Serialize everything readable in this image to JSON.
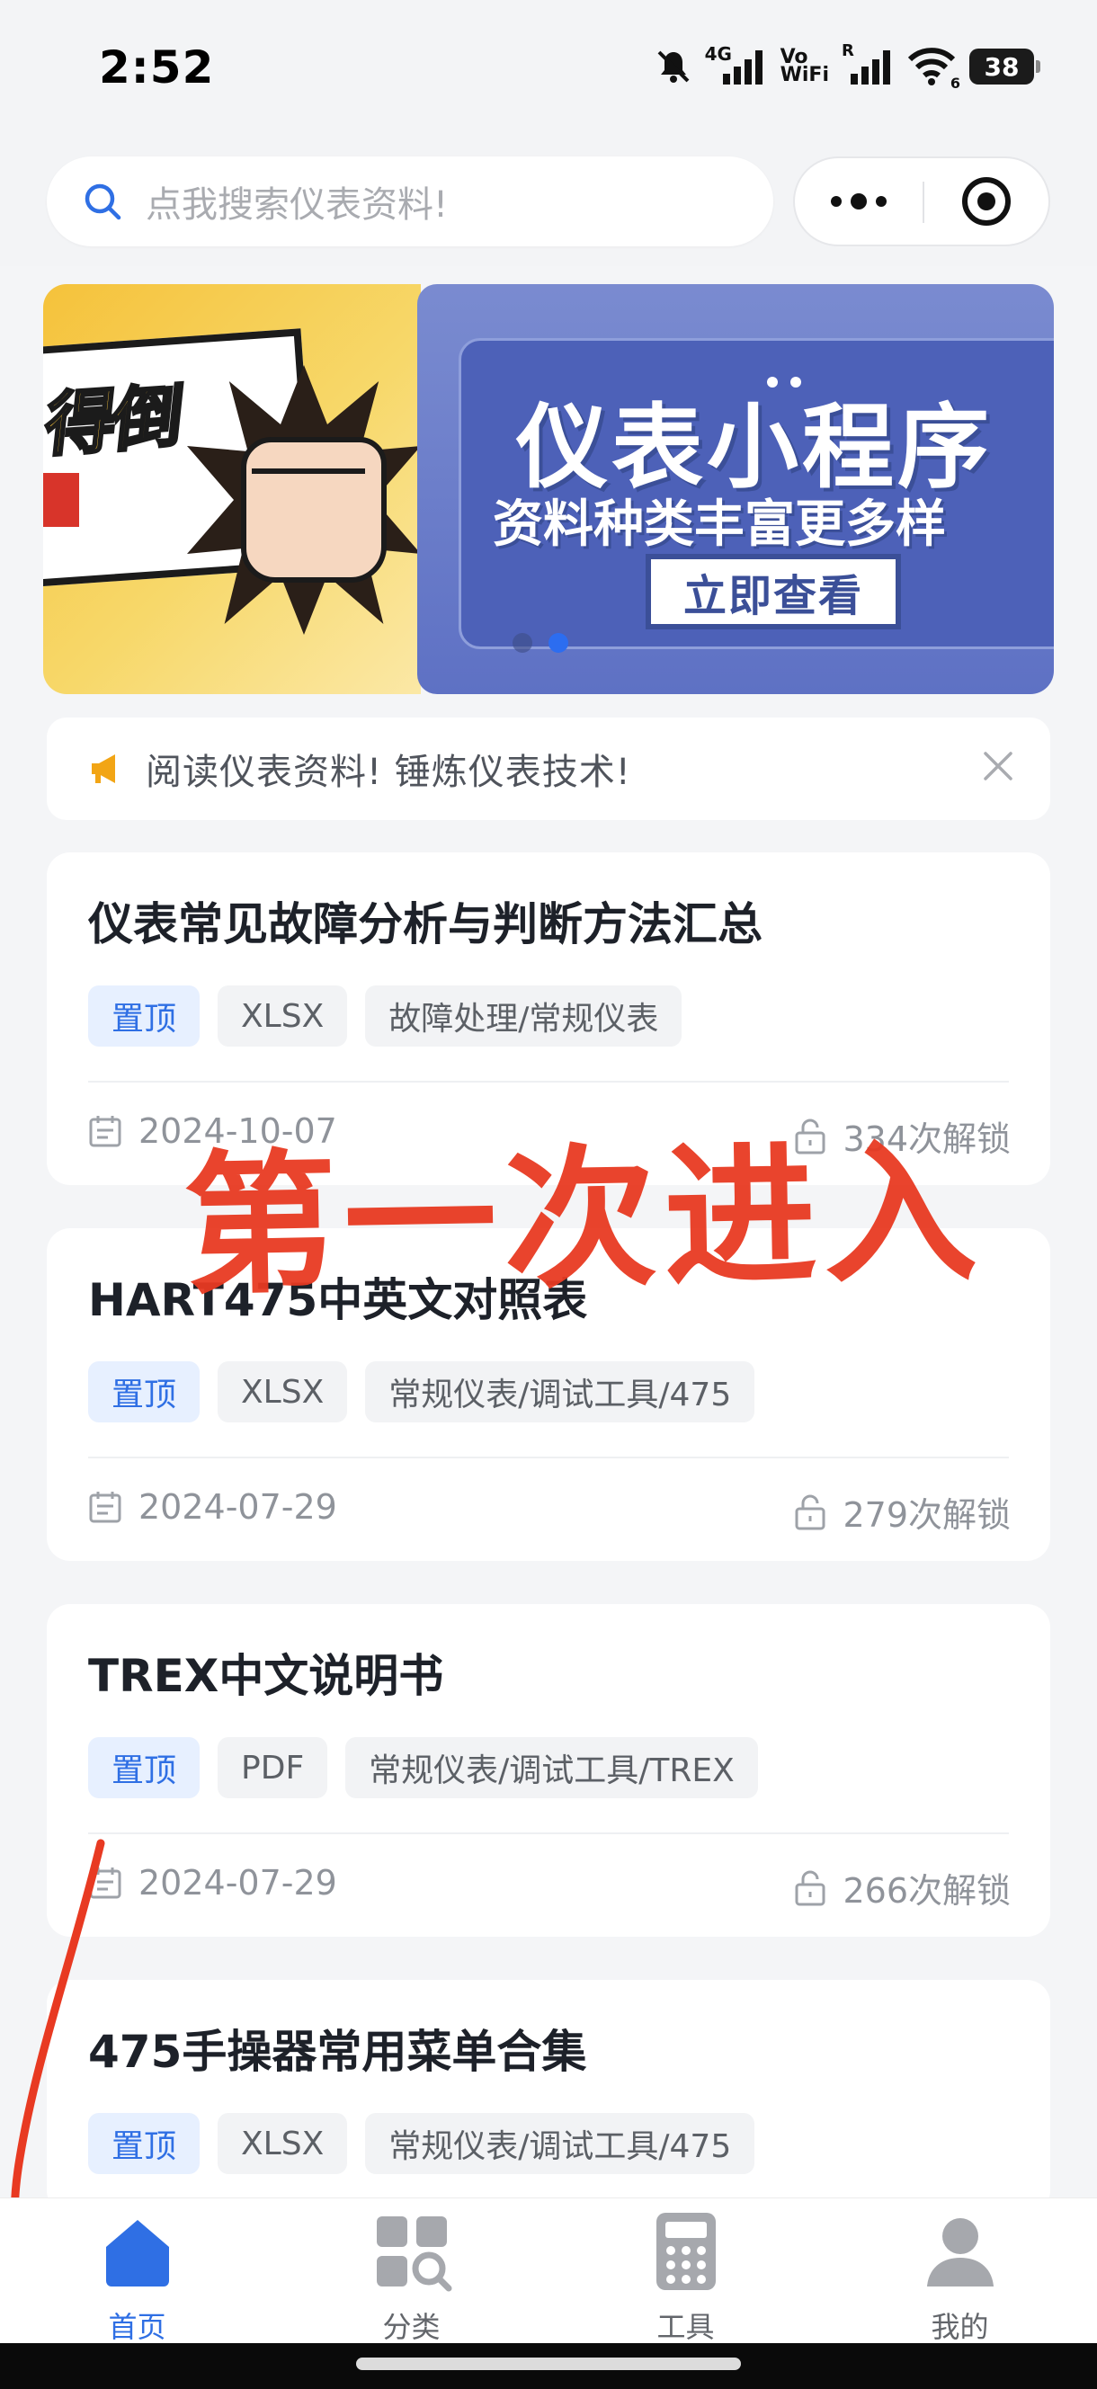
{
  "status_bar": {
    "time": "2:52",
    "network": "4G",
    "vo_label": "Vo",
    "wifi_label": "WiFi",
    "roaming_label": "R",
    "wifi_version": "6",
    "battery": "38"
  },
  "search": {
    "placeholder": "点我搜索仪表资料!"
  },
  "banner": {
    "left_text": "得倒",
    "title": "仪表小程序",
    "subtitle": "资料种类丰富更多样",
    "cta": "立即查看",
    "active_index": 1,
    "slide_count": 2
  },
  "notice": {
    "text": "阅读仪表资料! 锤炼仪表技术!"
  },
  "cards": [
    {
      "title": "仪表常见故障分析与判断方法汇总",
      "tags": [
        "置顶",
        "XLSX",
        "故障处理/常规仪表"
      ],
      "date": "2024-10-07",
      "unlocks": "334次解锁"
    },
    {
      "title": "HART475中英文对照表",
      "tags": [
        "置顶",
        "XLSX",
        "常规仪表/调试工具/475"
      ],
      "date": "2024-07-29",
      "unlocks": "279次解锁"
    },
    {
      "title": "TREX中文说明书",
      "tags": [
        "置顶",
        "PDF",
        "常规仪表/调试工具/TREX"
      ],
      "date": "2024-07-29",
      "unlocks": "266次解锁"
    },
    {
      "title": "475手操器常用菜单合集",
      "tags": [
        "置顶",
        "XLSX",
        "常规仪表/调试工具/475"
      ]
    }
  ],
  "overlay_annotation": "第一次进入",
  "tabbar": [
    {
      "label": "首页",
      "icon": "home-icon",
      "active": true
    },
    {
      "label": "分类",
      "icon": "category-icon",
      "active": false
    },
    {
      "label": "工具",
      "icon": "calculator-icon",
      "active": false
    },
    {
      "label": "我的",
      "icon": "user-icon",
      "active": false
    }
  ],
  "colors": {
    "accent": "#2f6fe4",
    "overlay_red": "#e83a22",
    "pin_tag_bg": "#e7f0ff"
  }
}
